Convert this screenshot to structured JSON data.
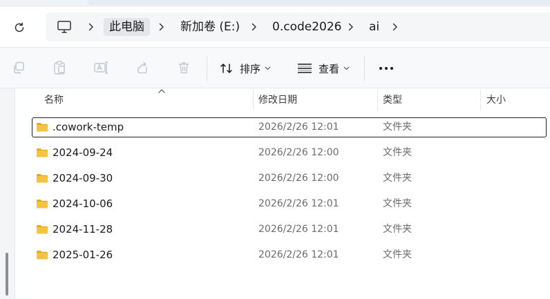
{
  "breadcrumb": {
    "items": [
      {
        "label": "此电脑"
      },
      {
        "label": "新加卷 (E:)"
      },
      {
        "label": "0.code2026"
      },
      {
        "label": "ai"
      }
    ]
  },
  "toolbar": {
    "sort_label": "排序",
    "view_label": "查看",
    "icons": [
      "copy-icon",
      "paste-icon",
      "rename-icon",
      "share-icon",
      "delete-icon",
      "sort-icon",
      "view-icon",
      "more-icon"
    ]
  },
  "columns": {
    "name": "名称",
    "modified": "修改日期",
    "type": "类型",
    "size": "大小"
  },
  "files": [
    {
      "name": ".cowork-temp",
      "modified": "2026/2/26 12:01",
      "type": "文件夹"
    },
    {
      "name": "2024-09-24",
      "modified": "2026/2/26 12:00",
      "type": "文件夹"
    },
    {
      "name": "2024-09-30",
      "modified": "2026/2/26 12:00",
      "type": "文件夹"
    },
    {
      "name": "2024-10-06",
      "modified": "2026/2/26 12:01",
      "type": "文件夹"
    },
    {
      "name": "2024-11-28",
      "modified": "2026/2/26 12:01",
      "type": "文件夹"
    },
    {
      "name": "2025-01-26",
      "modified": "2026/2/26 12:01",
      "type": "文件夹"
    }
  ],
  "colors": {
    "folder": "#f5c342",
    "folder_dark": "#e8a913",
    "selection_border": "#1f1f1f"
  }
}
